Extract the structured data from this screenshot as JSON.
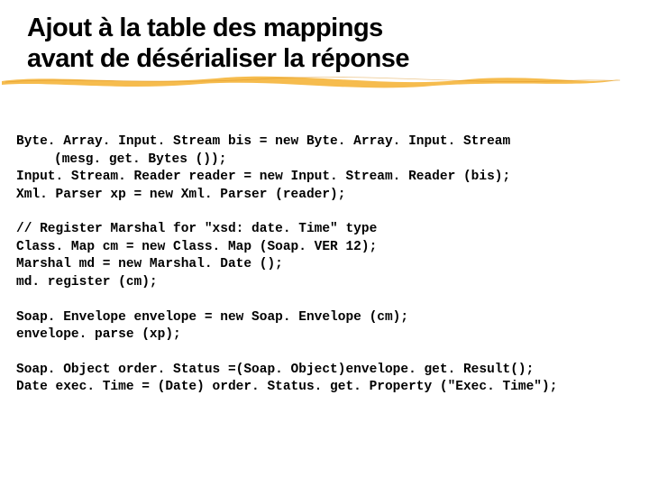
{
  "title": {
    "line1": "Ajout à la table des mappings",
    "line2": "avant de désérialiser la réponse"
  },
  "code": {
    "p1l1": "Byte. Array. Input. Stream bis = new Byte. Array. Input. Stream",
    "p1l2": "(mesg. get. Bytes ());",
    "p1l3": "Input. Stream. Reader reader = new Input. Stream. Reader (bis);",
    "p1l4": "Xml. Parser xp = new Xml. Parser (reader);",
    "p2l1": "// Register Marshal for \"xsd: date. Time\" type",
    "p2l2": "Class. Map cm = new Class. Map (Soap. VER 12);",
    "p2l3": "Marshal md = new Marshal. Date ();",
    "p2l4": "md. register (cm);",
    "p3l1": "Soap. Envelope envelope = new Soap. Envelope (cm);",
    "p3l2": "envelope. parse (xp);",
    "p4l1": "Soap. Object order. Status =(Soap. Object)envelope. get. Result();",
    "p4l2": "Date exec. Time = (Date) order. Status. get. Property (\"Exec. Time\");"
  }
}
